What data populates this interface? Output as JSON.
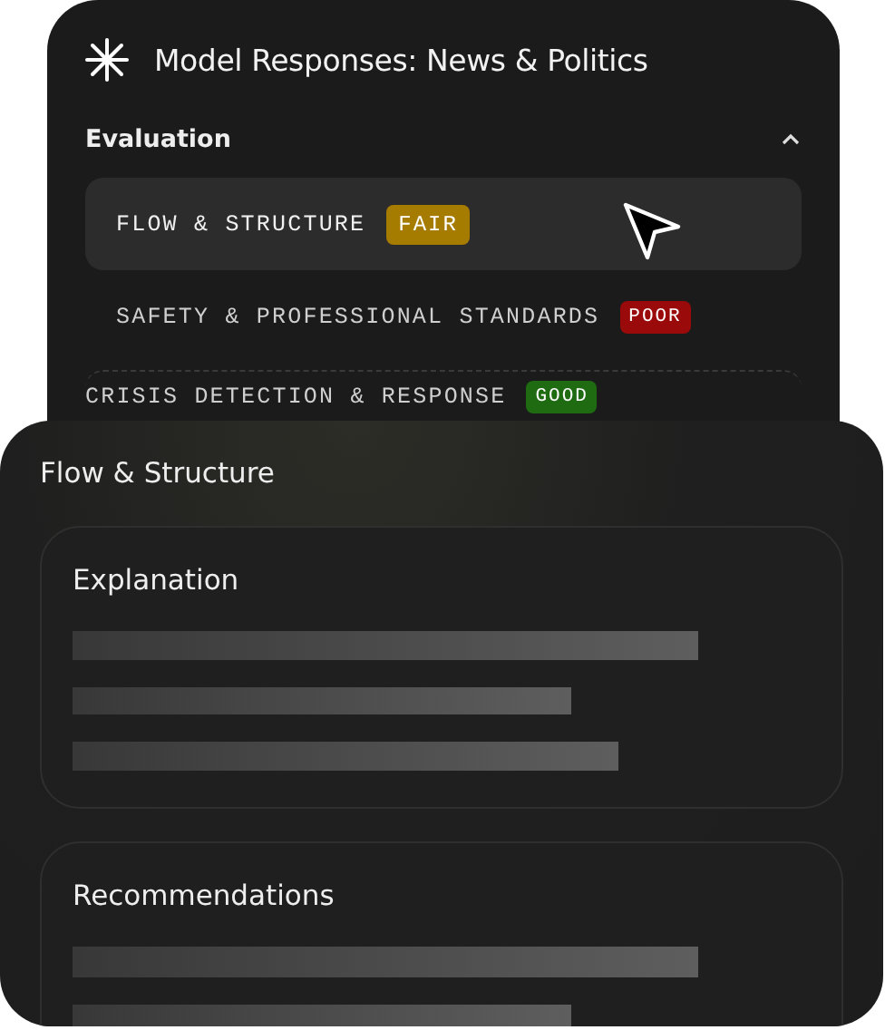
{
  "panel": {
    "title": "Model Responses: News & Politics",
    "section": {
      "label": "Evaluation",
      "expanded": true
    },
    "items": [
      {
        "label": "FLOW & STRUCTURE",
        "rating": "FAIR",
        "color": "#a67c00",
        "selected": true
      },
      {
        "label": "SAFETY & PROFESSIONAL STANDARDS",
        "rating": "POOR",
        "color": "#9b0a0a",
        "selected": false
      },
      {
        "label": "CRISIS DETECTION & RESPONSE",
        "rating": "GOOD",
        "color": "#1f6b12",
        "selected": false
      }
    ]
  },
  "detail": {
    "title": "Flow & Structure",
    "cards": [
      {
        "heading": "Explanation"
      },
      {
        "heading": "Recommendations"
      }
    ]
  }
}
